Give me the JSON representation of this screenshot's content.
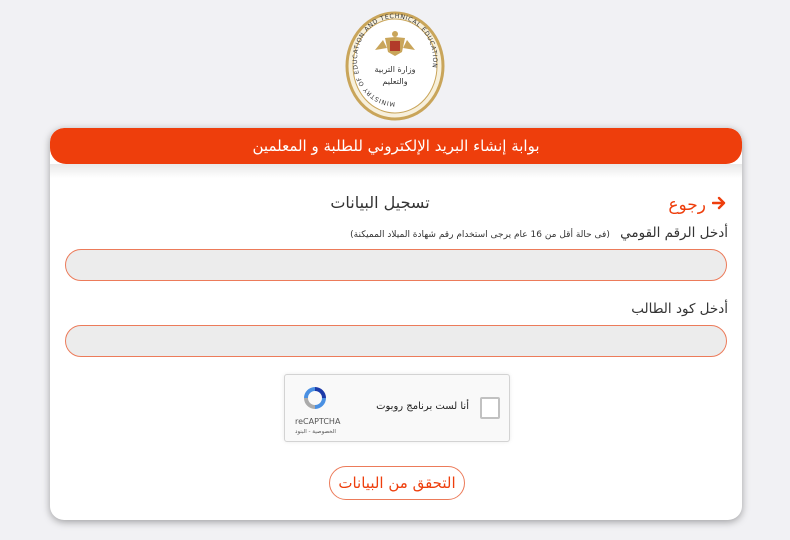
{
  "logo": {
    "text": "MINISTRY OF EDUCATION AND TECHNICAL EDUCATION",
    "arabic": "وزارة التربية والتعليم والتعليم الفني"
  },
  "header": {
    "title": "بوابة إنشاء البريد الإلكتروني للطلبة و المعلمين"
  },
  "form": {
    "back_label": "رجوع",
    "title": "تسجيل البيانات",
    "national_id": {
      "label": "أدخل الرقم القومي",
      "hint": "(فى حالة أقل من 16 عام يرجى استخدام رقم شهادة الميلاد المميكنة)",
      "value": ""
    },
    "student_code": {
      "label": "أدخل كود الطالب",
      "value": ""
    },
    "recaptcha": {
      "label": "أنا لست برنامج روبوت",
      "brand": "reCAPTCHA",
      "links": "الخصوصية - البنود"
    },
    "submit_label": "التحقق من البيانات"
  },
  "colors": {
    "accent": "#ee3e0c",
    "input_border": "#ec7b5a",
    "input_bg": "#ececec"
  }
}
